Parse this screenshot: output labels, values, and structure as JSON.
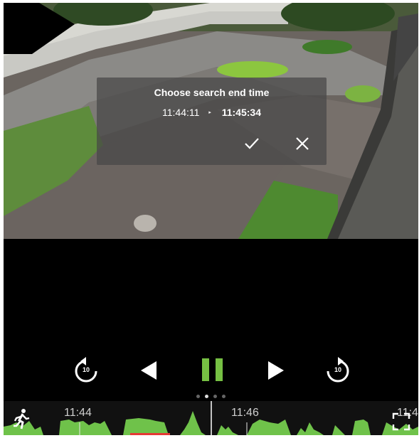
{
  "dialog": {
    "title": "Choose search end time",
    "start_time": "11:44:11",
    "arrow": "▸",
    "end_time": "11:45:34",
    "confirm_icon": "check-icon",
    "cancel_icon": "close-icon"
  },
  "controls": {
    "skip_back_seconds": "10",
    "skip_forward_seconds": "10",
    "icons": [
      "replay-10-icon",
      "previous-triangle-icon",
      "pause-icon",
      "next-triangle-icon",
      "forward-10-icon"
    ],
    "pause_color": "#76c043"
  },
  "pager": {
    "count": 4,
    "active": 1
  },
  "timeline": {
    "labels": [
      "11:44",
      "11:46",
      "11:4"
    ],
    "motion_color": "#6fc24a",
    "selection_color": "#e53935",
    "icons": [
      "motion-person-icon",
      "fullscreen-icon"
    ]
  }
}
